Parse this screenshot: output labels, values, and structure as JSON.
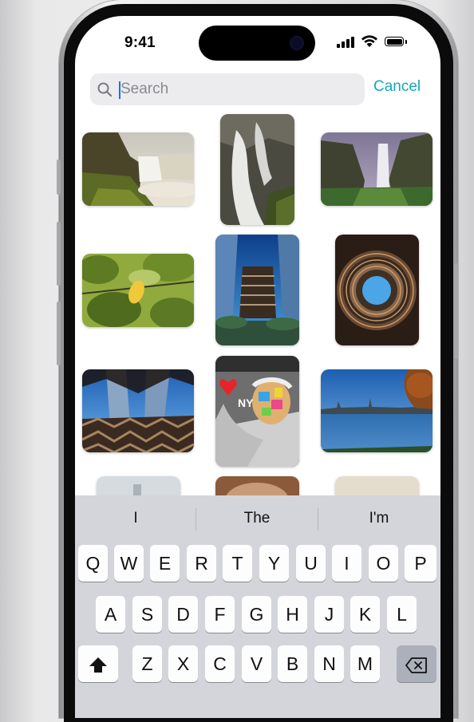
{
  "status_bar": {
    "time": "9:41"
  },
  "search": {
    "placeholder": "Search",
    "value": "",
    "cancel_label": "Cancel"
  },
  "photos": [
    {
      "label": "waterfall-cliff"
    },
    {
      "label": "waterfall-long-exposure"
    },
    {
      "label": "waterfall-canyon"
    },
    {
      "label": "lemon-tree"
    },
    {
      "label": "vessel-building"
    },
    {
      "label": "vessel-interior"
    },
    {
      "label": "skyscrapers-through-lattice"
    },
    {
      "label": "einstein-mural"
    },
    {
      "label": "reservoir-skyline"
    }
  ],
  "keyboard": {
    "suggestions": [
      "I",
      "The",
      "I'm"
    ],
    "row1": [
      "Q",
      "W",
      "E",
      "R",
      "T",
      "Y",
      "U",
      "I",
      "O",
      "P"
    ],
    "row2": [
      "A",
      "S",
      "D",
      "F",
      "G",
      "H",
      "J",
      "K",
      "L"
    ],
    "row3": [
      "Z",
      "X",
      "C",
      "V",
      "B",
      "N",
      "M"
    ]
  },
  "colors": {
    "accent": "#15a8b8",
    "caret": "#1a73e8",
    "keyboard_bg": "#d3d5db"
  }
}
